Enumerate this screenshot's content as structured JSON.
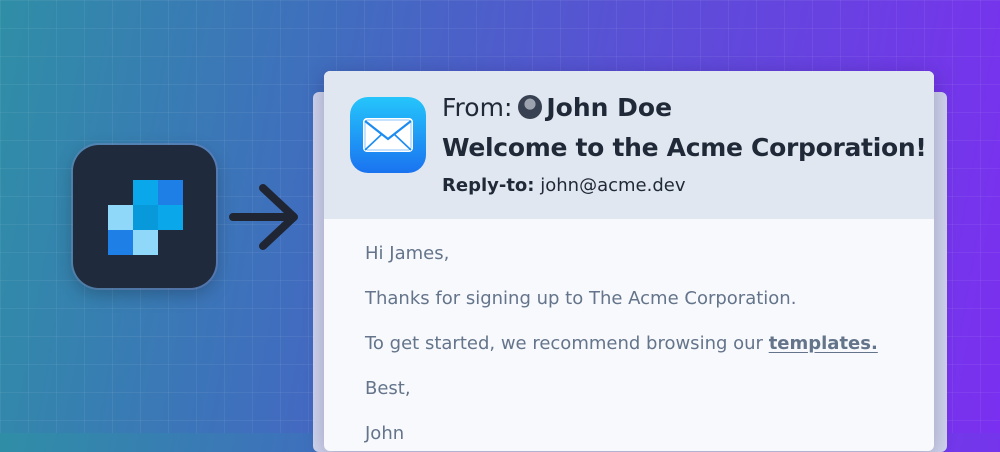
{
  "email": {
    "from_label": "From:",
    "from_name": "John Doe",
    "subject": "Welcome to the Acme Corporation!",
    "replyto_label": "Reply-to:",
    "replyto_value": "john@acme.dev",
    "body": {
      "greeting": "Hi James,",
      "line1": "Thanks for signing up to The Acme Corporation.",
      "line2": "To get started, we recommend browsing our",
      "link": "templates.",
      "closing": "Best,",
      "signature": "John"
    }
  },
  "icons": {
    "app": "app-logo-icon",
    "arrow": "arrow-right-icon",
    "mail": "mail-envelope-icon",
    "avatar": "avatar"
  },
  "colors": {
    "app_icon_bg": "#1f2a3c",
    "tile_dark": "#1e7fe6",
    "tile_mid": "#0aa8ea",
    "tile_light": "#8fd8fa",
    "mail_icon_top": "#25c5fb",
    "mail_icon_bottom": "#1a73f0",
    "header_bg": "#e1e7f0",
    "body_text": "#64748b"
  }
}
